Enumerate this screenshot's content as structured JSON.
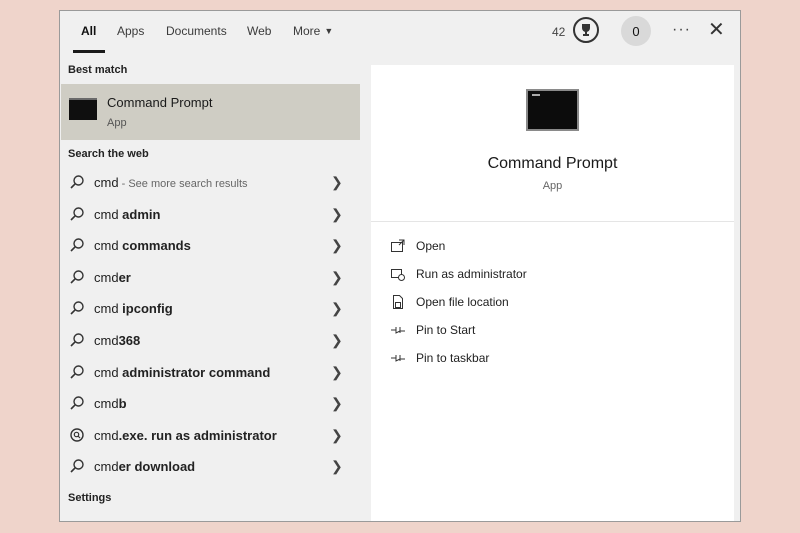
{
  "tabs": [
    {
      "label": "All",
      "active": true
    },
    {
      "label": "Apps"
    },
    {
      "label": "Documents"
    },
    {
      "label": "Web"
    },
    {
      "label": "More"
    }
  ],
  "header": {
    "points": "42",
    "zero_badge": "0",
    "more_options_icon": "ellipsis-icon",
    "close_icon": "close-icon"
  },
  "best_match": {
    "section_label": "Best match",
    "title": "Command Prompt",
    "subtitle": "App"
  },
  "search_web": {
    "section_label": "Search the web",
    "items": [
      {
        "query": "cmd",
        "bold": "",
        "suffix": " - See more search results",
        "icon": "search-icon"
      },
      {
        "query": "cmd ",
        "bold": "admin",
        "suffix": "",
        "icon": "search-icon"
      },
      {
        "query": "cmd ",
        "bold": "commands",
        "suffix": "",
        "icon": "search-icon"
      },
      {
        "query": "cmd",
        "bold": "er",
        "suffix": "",
        "icon": "search-icon"
      },
      {
        "query": "cmd ",
        "bold": "ipconfig",
        "suffix": "",
        "icon": "search-icon"
      },
      {
        "query": "cmd",
        "bold": "368",
        "suffix": "",
        "icon": "search-icon"
      },
      {
        "query": "cmd ",
        "bold": "administrator command",
        "suffix": "",
        "icon": "search-icon"
      },
      {
        "query": "cmd",
        "bold": "b",
        "suffix": "",
        "icon": "search-icon"
      },
      {
        "query": "cmd",
        "bold": ".exe. run as administrator",
        "suffix": "",
        "icon": "chat-search-icon"
      },
      {
        "query": "cmd",
        "bold": "er download",
        "suffix": "",
        "icon": "search-icon"
      }
    ]
  },
  "settings": {
    "section_label": "Settings"
  },
  "preview": {
    "title": "Command Prompt",
    "subtitle": "App",
    "actions": [
      {
        "label": "Open",
        "icon": "open-icon"
      },
      {
        "label": "Run as administrator",
        "icon": "shield-icon"
      },
      {
        "label": "Open file location",
        "icon": "file-location-icon"
      },
      {
        "label": "Pin to Start",
        "icon": "pin-icon"
      },
      {
        "label": "Pin to taskbar",
        "icon": "pin-icon"
      }
    ]
  },
  "colors": {
    "background": "#efd4cb",
    "panel": "#f0f0f0",
    "selected_row": "#cfcdc4",
    "preview_bg": "#ffffff"
  }
}
